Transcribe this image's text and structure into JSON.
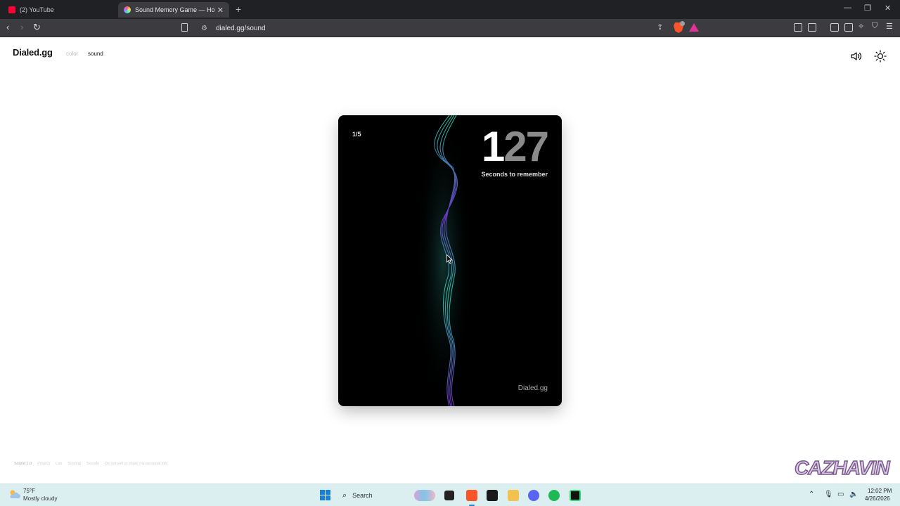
{
  "browser": {
    "tabs": [
      {
        "title": "(2) YouTube",
        "favicon": "youtube-icon"
      },
      {
        "title": "Sound Memory Game — How",
        "favicon": "dialed-icon",
        "active": true
      }
    ],
    "url": "dialed.gg/sound"
  },
  "page": {
    "logo": "Dialed.gg",
    "nav": {
      "color": "color",
      "sound": "sound"
    },
    "card": {
      "progress": "1/5",
      "countdown_lead": "1",
      "countdown_tail": "27",
      "countdown_label": "Seconds to remember",
      "brand": "Dialed.gg"
    },
    "footer": [
      "Sound 1.0",
      "Privacy",
      "Lab",
      "Scoring",
      "Society",
      "Do not sell or share my personal info"
    ]
  },
  "watermark": "CAZHAVIN",
  "taskbar": {
    "weather_temp": "75°F",
    "weather_desc": "Mostly cloudy",
    "search_label": "Search",
    "time": "12:02 PM",
    "date": "4/26/2026"
  },
  "colors": {
    "accent_teal": "#2fd6b4",
    "accent_purple": "#7b3fe0",
    "brave_orange": "#fb542b",
    "taskbar_bg": "#dbeef0"
  }
}
